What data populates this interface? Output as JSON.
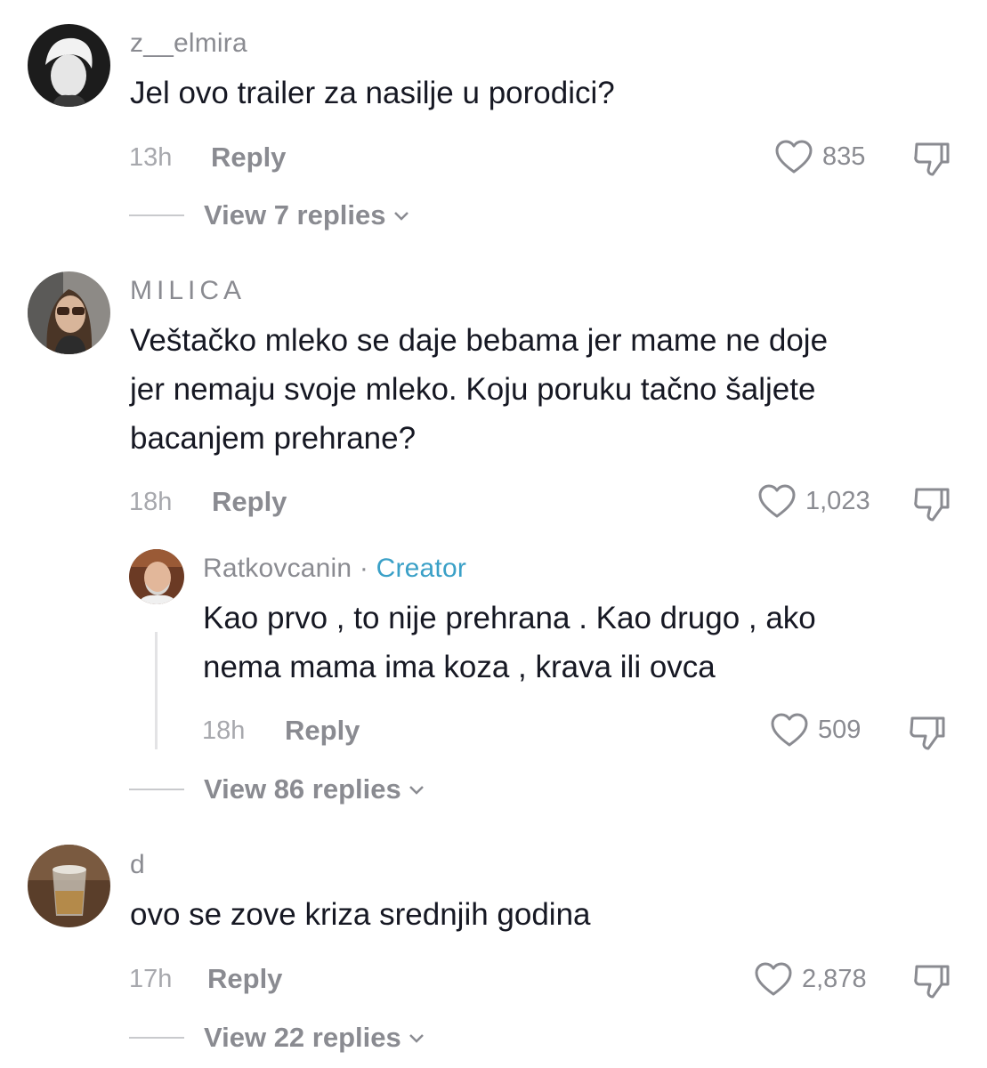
{
  "colors": {
    "text": "#161823",
    "muted": "#8a8b91",
    "creator": "#3aa0c7"
  },
  "comments": [
    {
      "username": "z__elmira",
      "text": [
        "Jel ovo trailer za nasilje u porodici?"
      ],
      "time": "13h",
      "reply_label": "Reply",
      "likes": "835",
      "view_replies": "View 7 replies"
    },
    {
      "username": "MILICA",
      "text": [
        "Veštačko mleko se daje bebama jer mame ne doje",
        "jer nemaju svoje mleko. Koju poruku tačno šaljete",
        "bacanjem prehrane?"
      ],
      "time": "18h",
      "reply_label": "Reply",
      "likes": "1,023",
      "reply": {
        "username": "Ratkovcanin",
        "separator": "·",
        "badge": "Creator",
        "text": [
          "Kao prvo , to nije prehrana . Kao drugo , ako",
          "nema mama ima koza , krava ili ovca"
        ],
        "time": "18h",
        "reply_label": "Reply",
        "likes": "509"
      },
      "view_replies": "View 86 replies"
    },
    {
      "username": "d",
      "text": [
        "ovo se zove kriza srednjih godina"
      ],
      "time": "17h",
      "reply_label": "Reply",
      "likes": "2,878",
      "view_replies": "View 22 replies"
    }
  ],
  "icons": {
    "like": "heart-outline-icon",
    "dislike": "thumbs-down-icon",
    "expand": "chevron-down-icon"
  }
}
